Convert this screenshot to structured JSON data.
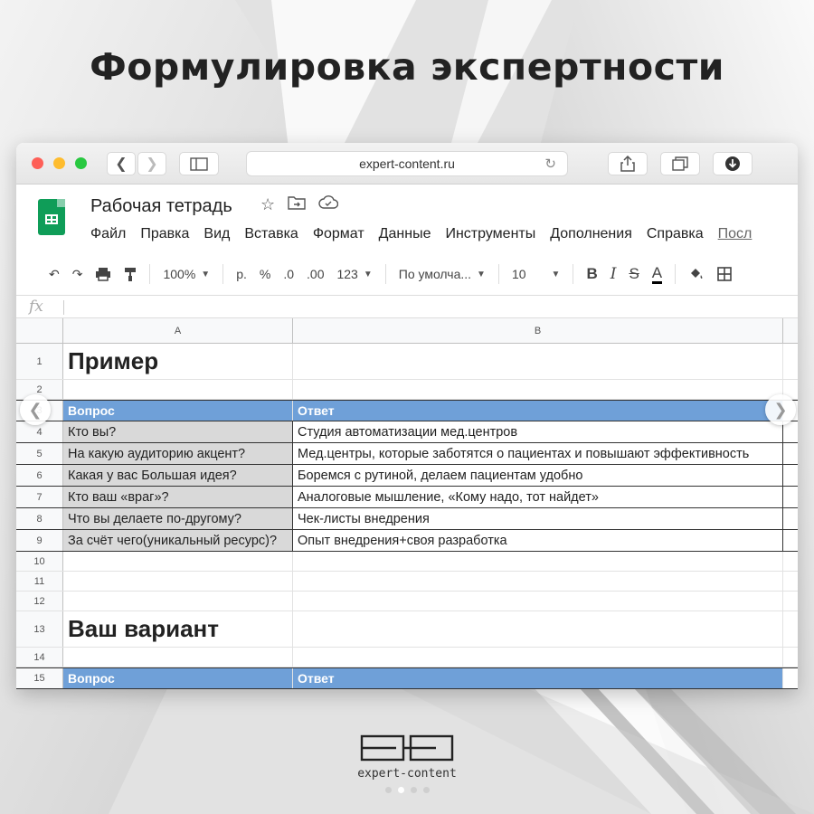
{
  "headline": "Формулировка экспертности",
  "browser": {
    "url": "expert-content.ru"
  },
  "sheet": {
    "title": "Рабочая тетрадь",
    "menu": [
      "Файл",
      "Правка",
      "Вид",
      "Вставка",
      "Формат",
      "Данные",
      "Инструменты",
      "Дополнения",
      "Справка",
      "Посл"
    ],
    "toolbar": {
      "zoom": "100%",
      "currency": "р.",
      "percent": "%",
      "dec_less": ".0",
      "dec_more": ".00",
      "format_more": "123",
      "font": "По умолча...",
      "font_size": "10",
      "bold": "B",
      "italic": "I",
      "strike": "S",
      "text_color": "A"
    },
    "formula_label": "fx",
    "columns": [
      "A",
      "B"
    ],
    "rows": [
      {
        "num": "1",
        "a": "Пример",
        "b": "",
        "style": "big"
      },
      {
        "num": "2",
        "a": "",
        "b": "",
        "style": "empty"
      },
      {
        "num": "3",
        "a": "Вопрос",
        "b": "Ответ",
        "style": "header"
      },
      {
        "num": "4",
        "a": "Кто вы?",
        "b": "Студия автоматизации мед.центров",
        "style": "qa"
      },
      {
        "num": "5",
        "a": "На какую аудиторию акцент?",
        "b": "Мед.центры, которые заботятся о пациентах и повышают эффективность",
        "style": "qa"
      },
      {
        "num": "6",
        "a": "Какая у вас Большая идея?",
        "b": "Боремся с рутиной, делаем пациентам удобно",
        "style": "qa"
      },
      {
        "num": "7",
        "a": "Кто ваш «враг»?",
        "b": "Аналоговые мышление, «Кому надо, тот найдет»",
        "style": "qa"
      },
      {
        "num": "8",
        "a": "Что вы делаете по-другому?",
        "b": "Чек-листы внедрения",
        "style": "qa"
      },
      {
        "num": "9",
        "a": "За счёт чего(уникальный ресурс)?",
        "b": "Опыт внедрения+своя разработка",
        "style": "qa"
      },
      {
        "num": "10",
        "a": "",
        "b": "",
        "style": "empty"
      },
      {
        "num": "11",
        "a": "",
        "b": "",
        "style": "empty"
      },
      {
        "num": "12",
        "a": "",
        "b": "",
        "style": "empty"
      },
      {
        "num": "13",
        "a": "Ваш вариант",
        "b": "",
        "style": "big"
      },
      {
        "num": "14",
        "a": "",
        "b": "",
        "style": "empty"
      },
      {
        "num": "15",
        "a": "Вопрос",
        "b": "Ответ",
        "style": "header"
      }
    ]
  },
  "brand": {
    "name": "expert-content"
  },
  "colors": {
    "header_fill": "#6fa0d8",
    "question_fill": "#d9d9d9",
    "sheets_green": "#0f9d58"
  }
}
